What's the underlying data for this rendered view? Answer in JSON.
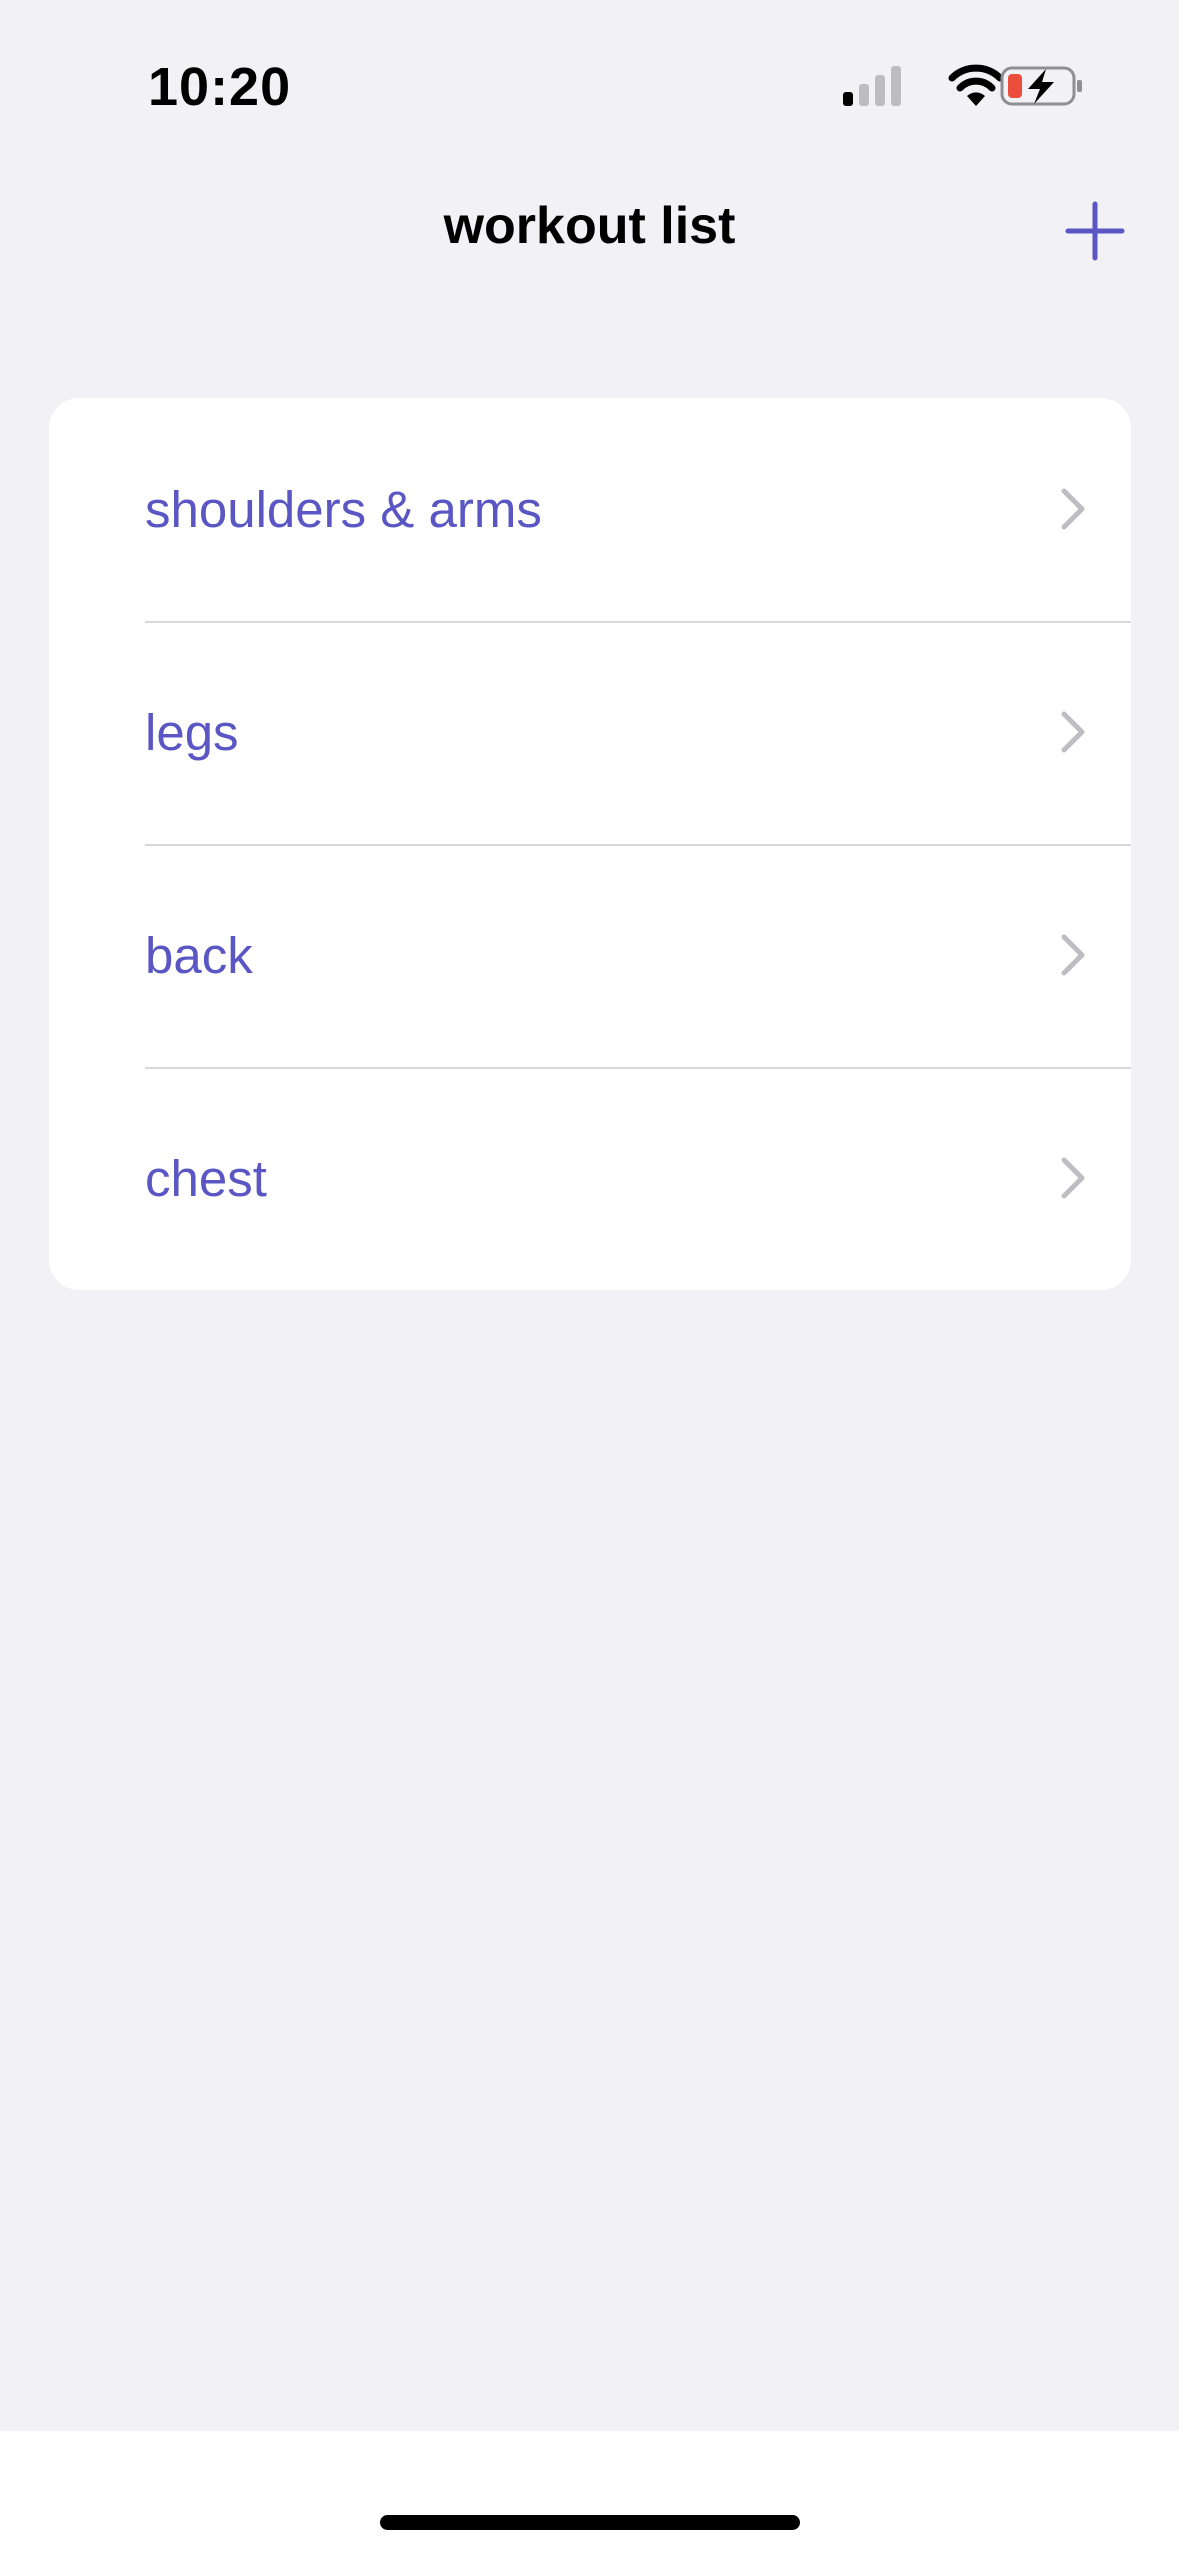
{
  "status_bar": {
    "time": "10:20",
    "icons": [
      "cellular-signal-icon",
      "wifi-icon",
      "battery-charging-icon"
    ],
    "battery_low_color": "#EB4E3D"
  },
  "nav": {
    "title": "workout list",
    "add_icon": "plus-icon"
  },
  "workouts": [
    {
      "label": "shoulders & arms"
    },
    {
      "label": "legs"
    },
    {
      "label": "back"
    },
    {
      "label": "chest"
    }
  ],
  "colors": {
    "accent": "#5A57C5",
    "background": "#F1F1F6",
    "card": "#FFFFFF",
    "separator": "#D7D7DC",
    "chevron": "#BDBDC2"
  }
}
